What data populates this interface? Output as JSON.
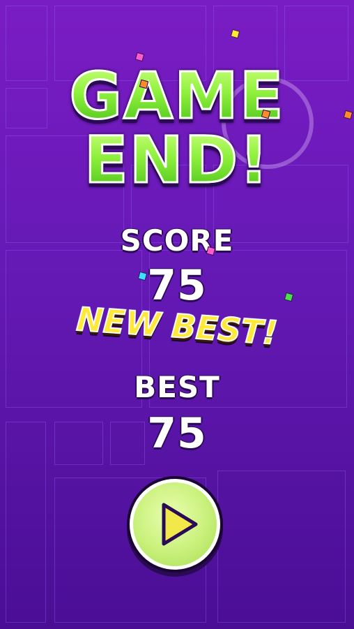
{
  "title": {
    "line1": "GAME",
    "line2": "END!"
  },
  "score": {
    "label": "SCORE",
    "value": "75"
  },
  "new_best": "NEW BEST!",
  "best": {
    "label": "BEST",
    "value": "75"
  },
  "play_button": {
    "icon": "play-icon"
  },
  "colors": {
    "background_top": "#7a1cc4",
    "background_bottom": "#4a0e94",
    "title_green": "#8ef03c",
    "new_best_yellow": "#ffe838",
    "button_green": "#c8f07a"
  }
}
